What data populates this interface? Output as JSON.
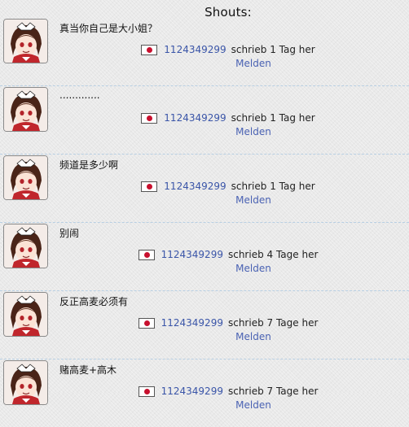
{
  "header": {
    "title": "Shouts:"
  },
  "shouts": [
    {
      "message": "真当你自己是大小姐？",
      "username": "1124349299",
      "time_text": "schrieb 1 Tag her",
      "report_label": "Melden",
      "flag": "japan-flag-icon"
    },
    {
      "message": ".............",
      "username": "1124349299",
      "time_text": "schrieb 1 Tag her",
      "report_label": "Melden",
      "flag": "japan-flag-icon"
    },
    {
      "message": "频道是多少啊",
      "username": "1124349299",
      "time_text": "schrieb 1 Tag her",
      "report_label": "Melden",
      "flag": "japan-flag-icon"
    },
    {
      "message": "别闹",
      "username": "1124349299",
      "time_text": "schrieb 4 Tage her",
      "report_label": "Melden",
      "flag": "japan-flag-icon"
    },
    {
      "message": "反正高麦必须有",
      "username": "1124349299",
      "time_text": "schrieb 7 Tage her",
      "report_label": "Melden",
      "flag": "japan-flag-icon"
    },
    {
      "message": "赌高麦+高木",
      "username": "1124349299",
      "time_text": "schrieb 7 Tage her",
      "report_label": "Melden",
      "flag": "japan-flag-icon"
    }
  ],
  "colors": {
    "background": "#e9e9e9",
    "link": "#3a55a8",
    "divider": "#b8cfe3",
    "flag_red": "#c8102e"
  }
}
